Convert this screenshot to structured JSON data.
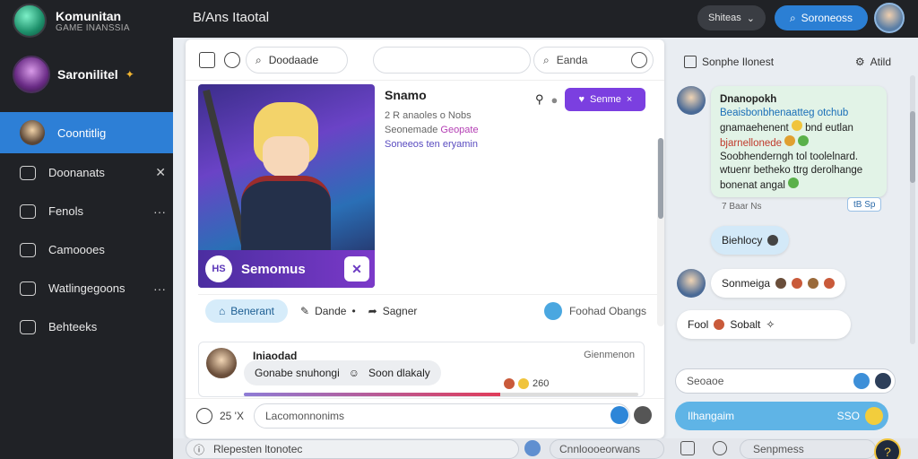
{
  "brand": {
    "title": "Komunitan",
    "subtitle": "GAME INANSSIA"
  },
  "profile": {
    "name": "Saronilitel",
    "badge": "✦"
  },
  "nav": {
    "items": [
      {
        "label": "Coontitlig",
        "trail": ""
      },
      {
        "label": "Doonanats",
        "trail": "✕"
      },
      {
        "label": "Fenols",
        "trail": "···"
      },
      {
        "label": "Camoooes",
        "trail": ""
      },
      {
        "label": "Watlingegoons",
        "trail": "···"
      },
      {
        "label": "Behteeks",
        "trail": ""
      }
    ]
  },
  "topbar": {
    "title": "B/Ans Itaotal",
    "select_label": "Shiteas",
    "search_label": "Soroneoss"
  },
  "toolbar": {
    "search_label": "Doodaade",
    "search2_label": "Eanda"
  },
  "post": {
    "title": "Snamo",
    "meta": "2 R anaoles o Nobs",
    "tags_prefix": "Seonemade",
    "tag": "Geopate",
    "link": "Soneeos ten eryamin",
    "follow_label": "Senme",
    "banner_badge": "HS",
    "banner_text": "Semomus",
    "actions": {
      "home": "Benerant",
      "comment": "Dande",
      "comment_suffix": "•",
      "share": "Sagner",
      "right": "Foohad Obangs"
    }
  },
  "comment": {
    "name": "Iniaodad",
    "bubble_text": "Gonabe snuhongi",
    "bubble_text2": "Soon dlakaly",
    "date": "Gienmenon",
    "stats": "260",
    "progress": 0.65
  },
  "reply": {
    "count": "25 'X",
    "placeholder": "Lacomonnonims"
  },
  "bottombar": {
    "input1": "Rlepesten ltonotec",
    "input2": "Cnnloooeorwans",
    "input3": "Senpmess"
  },
  "chat": {
    "header_left": "Sonphe Ilonest",
    "header_right": "Atild",
    "msg1": {
      "name": "Dnanopokh",
      "line1": "Beaisbonbhenaatteg otchub",
      "line2": "gnamaehenent",
      "line2b": "bnd eutlan",
      "line3": "bjarnellonede",
      "line4": "Soobhenderngh tol toolelnard.",
      "line5": "wtuenr betheko ttrg derolhange",
      "line6": "bonenat angal",
      "time": "7 Baar Ns",
      "chip": "tB Sp"
    },
    "msg2": {
      "text": "Biehlocy"
    },
    "msg3": {
      "text": "Sonmeiga"
    },
    "msg4": {
      "prefix": "Fool",
      "text": "Sobalt"
    },
    "input_placeholder": "Seoaoe",
    "send_label": "Ilhangaim",
    "send_value": "SSO"
  }
}
